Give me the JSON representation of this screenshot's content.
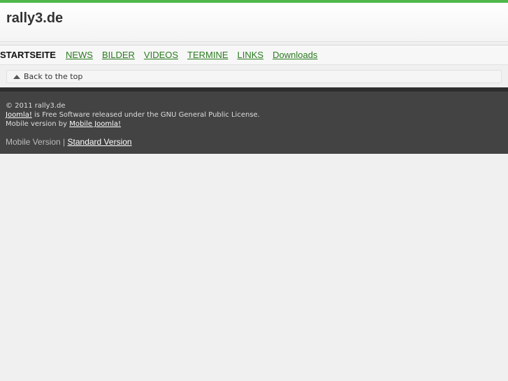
{
  "header": {
    "title": "rally3.de"
  },
  "nav": {
    "items": [
      {
        "label": "STARTSEITE",
        "active": true
      },
      {
        "label": "NEWS"
      },
      {
        "label": "BILDER"
      },
      {
        "label": "VIDEOS"
      },
      {
        "label": "TERMINE"
      },
      {
        "label": "LINKS"
      },
      {
        "label": "Downloads"
      }
    ]
  },
  "back_to_top": {
    "label": "Back to the top",
    "icon": "triangle-up-icon"
  },
  "footer": {
    "copyright": "© 2011 rally3.de",
    "joomla_link": "Joomla!",
    "license_text": " is Free Software released under the GNU General Public License.",
    "mobile_by_text": "Mobile version by ",
    "mobile_joomla_link": "Mobile Joomla!",
    "mobile_version_label": "Mobile Version",
    "separator": " | ",
    "standard_version_link": "Standard Version"
  },
  "colors": {
    "accent_green": "#4fb84a",
    "nav_link": "#2a7a1f",
    "footer_bg": "#434343",
    "page_bg": "#f0f0f0"
  }
}
